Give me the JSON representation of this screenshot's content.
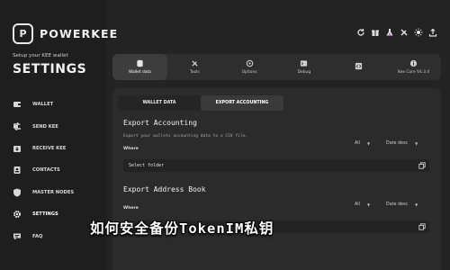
{
  "brand": {
    "logo_letter": "P",
    "name": "POWERKEE"
  },
  "header": {
    "subtitle": "Setup your KEE wallet",
    "title": "SETTINGS"
  },
  "sidebar": {
    "items": [
      {
        "label": "WALLET",
        "icon": "wallet-icon"
      },
      {
        "label": "SEND KEE",
        "icon": "send-icon"
      },
      {
        "label": "RECEIVE KEE",
        "icon": "receive-icon"
      },
      {
        "label": "CONTACTS",
        "icon": "contacts-icon"
      },
      {
        "label": "MASTER NODES",
        "icon": "shield-icon"
      },
      {
        "label": "SETTINGS",
        "icon": "gear-icon"
      },
      {
        "label": "FAQ",
        "icon": "faq-icon"
      }
    ],
    "active": "SETTINGS"
  },
  "topbar_icons": [
    "refresh-icon",
    "gift-icon",
    "flask-icon",
    "tools-icon",
    "sun-icon",
    "upload-icon"
  ],
  "tabs": [
    {
      "label": "Wallet data",
      "icon": "database-icon"
    },
    {
      "label": "Tools",
      "icon": "wrench-icon"
    },
    {
      "label": "Options",
      "icon": "options-icon"
    },
    {
      "label": "Debug",
      "icon": "terminal-icon"
    },
    {
      "label": "",
      "icon": "code-icon"
    },
    {
      "label": "Kee Core V4.3.4",
      "icon": "info-icon"
    }
  ],
  "subtabs": [
    "WALLET DATA",
    "EXPORT ACCOUNTING"
  ],
  "export_accounting": {
    "title": "Export Accounting",
    "description": "Export your wallets accounting data to a CSV file.",
    "where_label": "Where",
    "filter_all": "All",
    "filter_sort": "Date desc",
    "folder_value": "Select folder"
  },
  "export_address": {
    "title": "Export Address Book",
    "where_label": "Where",
    "filter_all": "All",
    "filter_sort": "Date desc"
  },
  "overlay_caption": "如何安全备份TokenIM私钥",
  "colors": {
    "background": "#232323",
    "sidebar": "#1e1e1e",
    "panel": "#2b2b2b",
    "accent": "#ffffff"
  }
}
